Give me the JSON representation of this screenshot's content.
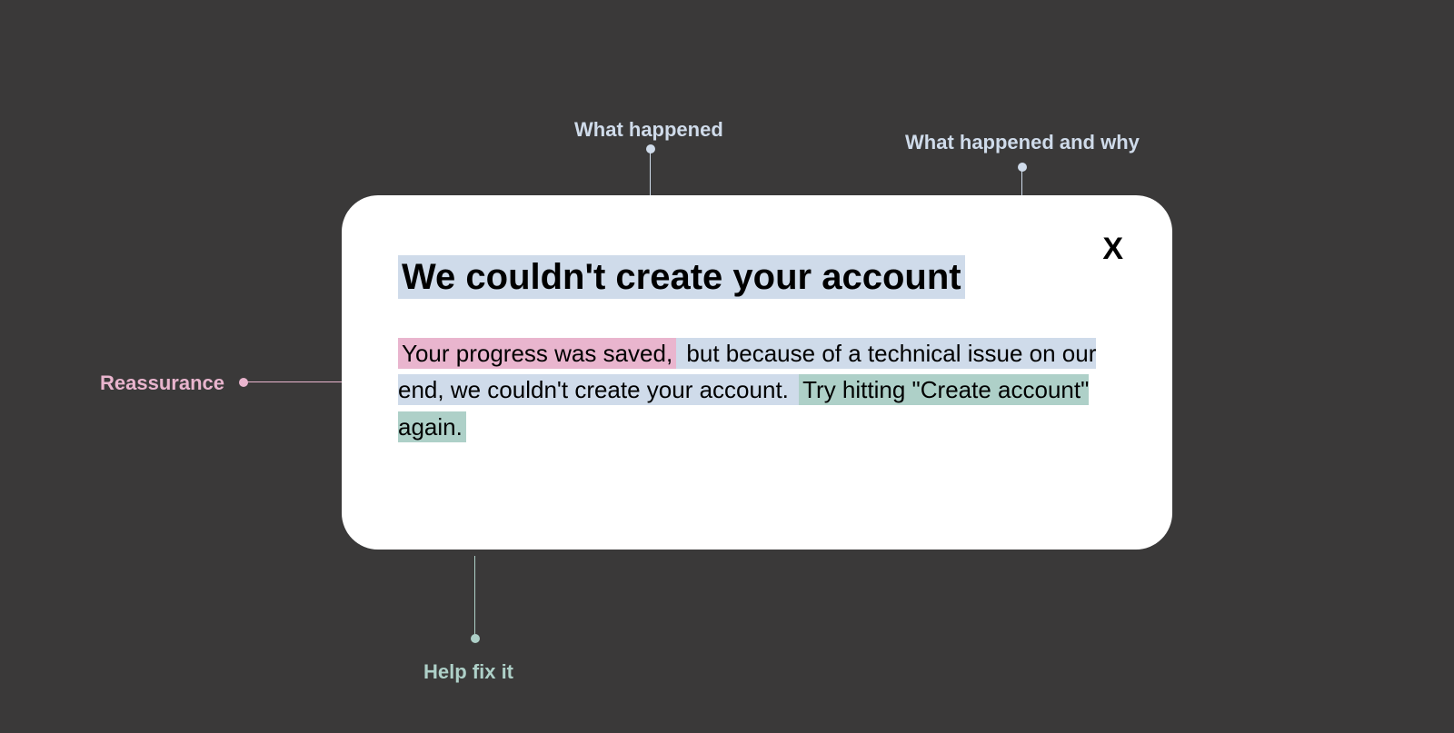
{
  "annotations": {
    "what_happened": "What happened",
    "what_happened_why": "What happened and why",
    "reassurance": "Reassurance",
    "help_fix": "Help fix it"
  },
  "dialog": {
    "close_glyph": "X",
    "title": "We couldn't create your account",
    "body": {
      "reassurance_segment": "Your progress was saved,",
      "explanation_segment": " but because of a technical issue on our end, we couldn't create your account. ",
      "help_segment": " Try hitting \"Create account\" again."
    }
  },
  "colors": {
    "highlight_blue": "#cfdbea",
    "highlight_pink": "#e9b5ce",
    "highlight_teal": "#aed0c8",
    "dialog_bg": "#ffffff",
    "page_bg": "#3a3939"
  }
}
